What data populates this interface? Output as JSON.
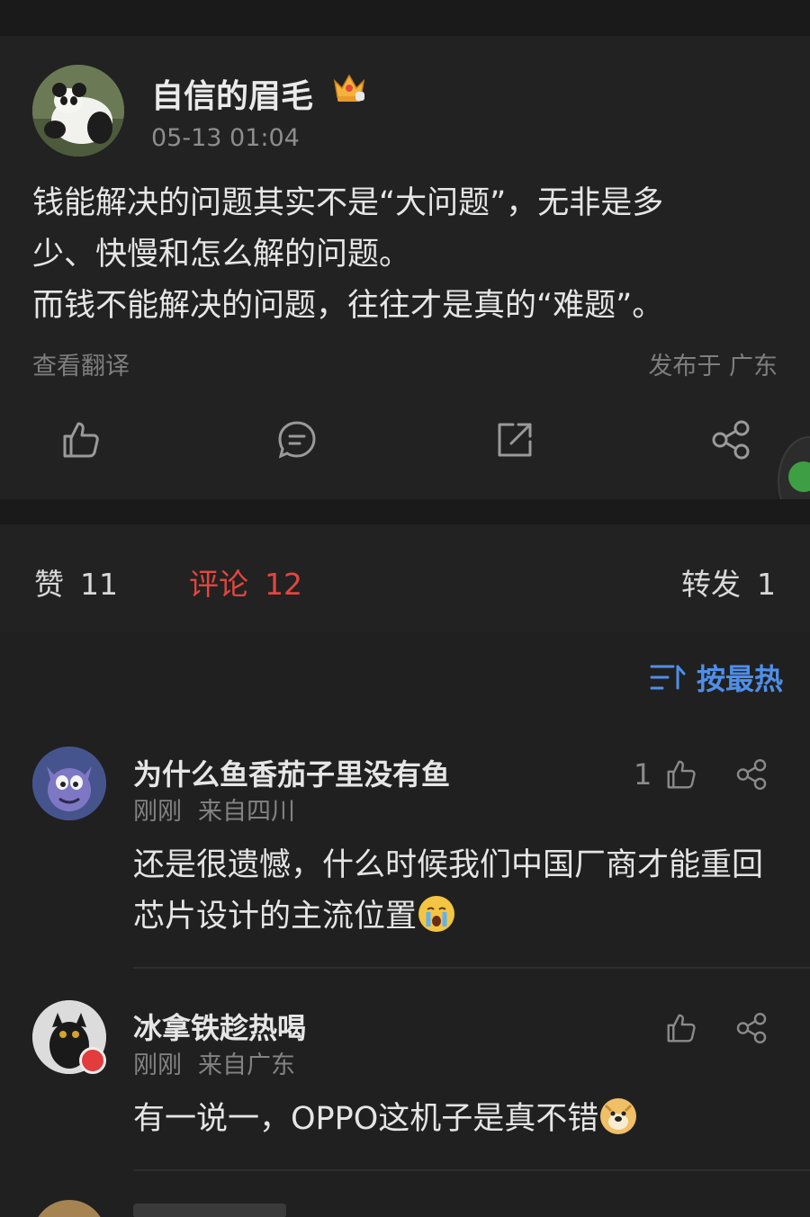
{
  "post": {
    "author": "自信的眉毛",
    "time": "05-13 01:04",
    "body": "钱能解决的问题其实不是“大问题”，无非是多\n少、快慢和怎么解的问题。\n而钱不能解决的问题，往往才是真的“难题”。",
    "translate_label": "查看翻译",
    "location": "发布于 广东",
    "actions": [
      "like-icon",
      "comment-icon",
      "repost-icon",
      "share-icon"
    ]
  },
  "tabs": {
    "likes_label": "赞",
    "likes_count": "11",
    "comments_label": "评论",
    "comments_count": "12",
    "reposts_label": "转发",
    "reposts_count": "1"
  },
  "sort": {
    "label": "按最热"
  },
  "comments": [
    {
      "name": "为什么鱼香茄子里没有鱼",
      "time": "刚刚",
      "from": "来自四川",
      "text": "还是很遗憾，什么时候我们中国厂商才能重回芯片设计的主流位置",
      "emoji": "crying-emoji",
      "likes": "1"
    },
    {
      "name": "冰拿铁趁热喝",
      "time": "刚刚",
      "from": "来自广东",
      "text": "有一说一，OPPO这机子是真不错",
      "emoji": "doge-emoji",
      "likes": ""
    }
  ],
  "colors": {
    "accent_red": "#e3463f",
    "accent_blue": "#4f8fe8",
    "background": "#202020"
  }
}
